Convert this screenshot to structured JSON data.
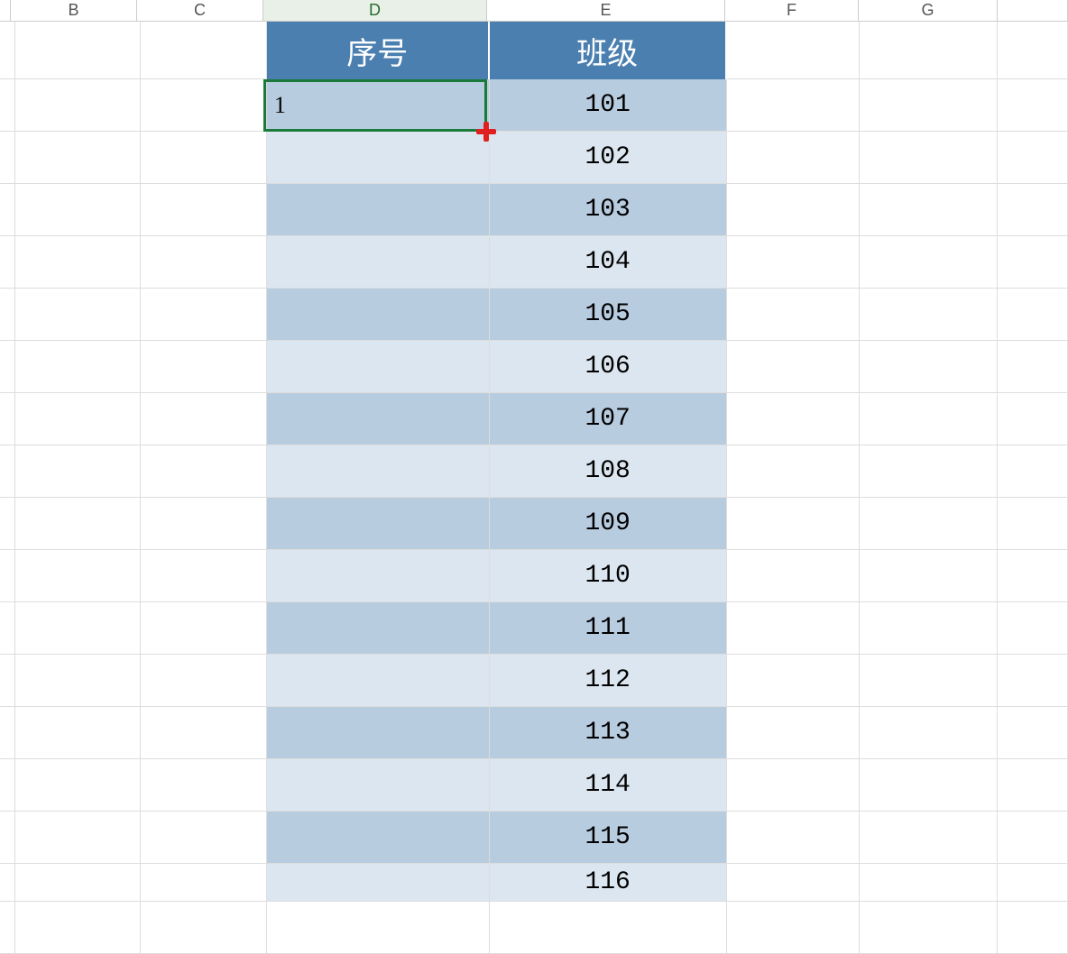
{
  "columns": [
    "B",
    "C",
    "D",
    "E",
    "F",
    "G"
  ],
  "activeColumn": "D",
  "headers": {
    "d": "序号",
    "e": "班级"
  },
  "selectedCellValue": "1",
  "dataRows": [
    {
      "d": "1",
      "e": "101"
    },
    {
      "d": "",
      "e": "102"
    },
    {
      "d": "",
      "e": "103"
    },
    {
      "d": "",
      "e": "104"
    },
    {
      "d": "",
      "e": "105"
    },
    {
      "d": "",
      "e": "106"
    },
    {
      "d": "",
      "e": "107"
    },
    {
      "d": "",
      "e": "108"
    },
    {
      "d": "",
      "e": "109"
    },
    {
      "d": "",
      "e": "110"
    },
    {
      "d": "",
      "e": "111"
    },
    {
      "d": "",
      "e": "112"
    },
    {
      "d": "",
      "e": "113"
    },
    {
      "d": "",
      "e": "114"
    },
    {
      "d": "",
      "e": "115"
    },
    {
      "d": "",
      "e": "116"
    }
  ],
  "colors": {
    "headerBg": "#4a7fb0",
    "shadeDark": "#b8cce0",
    "shadeLight": "#dce6f0",
    "selection": "#1a7a3a",
    "fillHandle": "#e02020"
  }
}
